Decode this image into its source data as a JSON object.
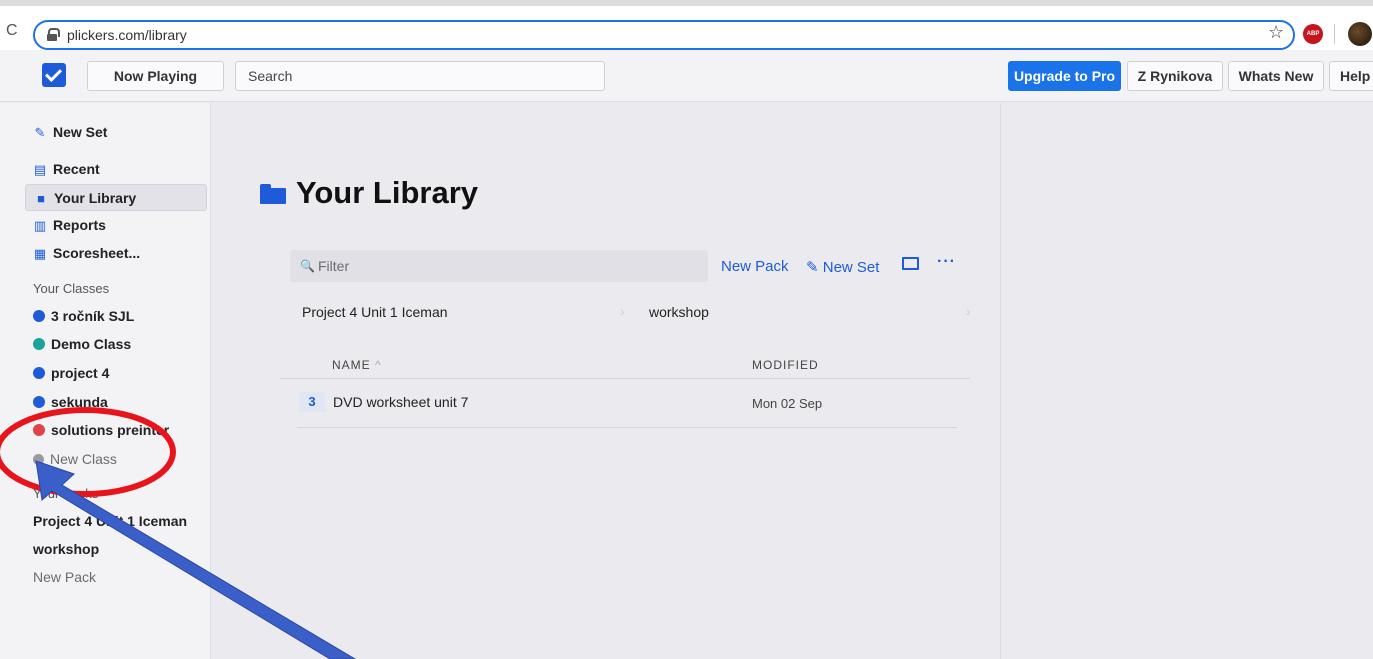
{
  "browser": {
    "url": "plickers.com/library",
    "reload_glyph": "C",
    "star_glyph": "☆",
    "abp_label": "ABP"
  },
  "topbar": {
    "now_playing": "Now Playing",
    "search_placeholder": "Search",
    "upgrade": "Upgrade to Pro",
    "user": "Z Rynikova",
    "whats_new": "Whats New",
    "help": "Help"
  },
  "sidebar": {
    "new_set": "New Set",
    "recent": "Recent",
    "your_library": "Your Library",
    "reports": "Reports",
    "scoresheet": "Scoresheet...",
    "classes_label": "Your Classes",
    "classes": [
      {
        "name": "3 ročník SJL",
        "color": "#1e5bd9"
      },
      {
        "name": "Demo Class",
        "color": "#1aa39a"
      },
      {
        "name": "project 4",
        "color": "#1e5bd9"
      },
      {
        "name": "sekunda",
        "color": "#1e5bd9"
      },
      {
        "name": "solutions preinter",
        "color": "#e0424a"
      }
    ],
    "new_class": "New Class",
    "packs_label": "Your Packs",
    "packs": [
      "Project 4 Unit 1 Iceman",
      "workshop"
    ],
    "new_pack": "New Pack"
  },
  "main": {
    "title": "Your Library",
    "filter_placeholder": "Filter",
    "new_pack": "New Pack",
    "new_set": "New Set",
    "more": "···",
    "pack_tiles": [
      "Project 4 Unit 1 Iceman",
      "workshop"
    ],
    "col_name": "NAME",
    "col_sort": "^",
    "col_modified": "MODIFIED",
    "rows": [
      {
        "count": "3",
        "name": "DVD worksheet unit 7",
        "modified": "Mon 02 Sep"
      }
    ]
  },
  "colors": {
    "accent": "#1e5bd9",
    "upgrade": "#1a73e8",
    "annotation_red": "#e8141b",
    "annotation_arrow": "#3a5fc8"
  },
  "icons": [
    "lock-icon",
    "star-icon",
    "adblock-icon",
    "extension-avatar",
    "logo-check-icon",
    "edit-icon",
    "recent-icon",
    "folder-icon",
    "reports-icon",
    "grid-icon",
    "plus-circle-icon",
    "search-icon",
    "more-icon"
  ]
}
